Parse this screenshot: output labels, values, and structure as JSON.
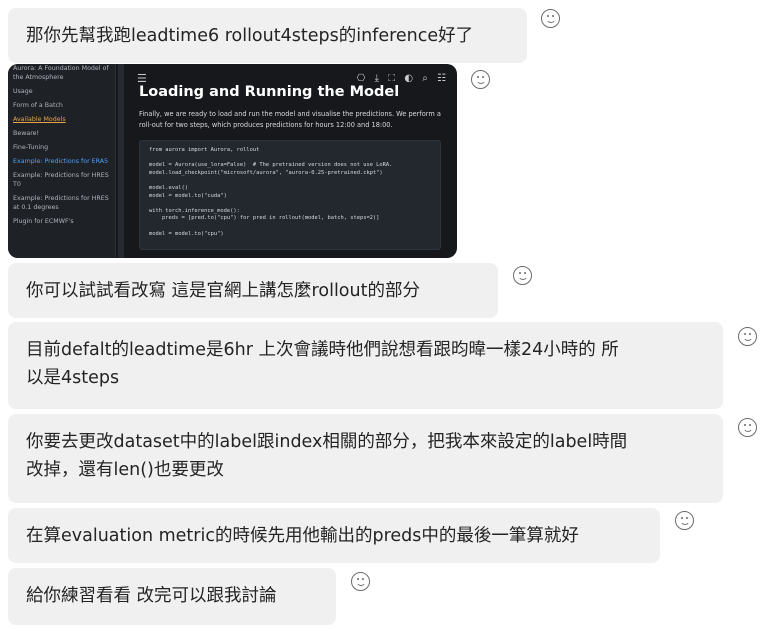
{
  "messages": [
    {
      "text": "那你先幫我跑leadtime6 rollout4steps的inference好了"
    },
    {
      "text": "你可以試試看改寫 這是官網上講怎麼rollout的部分"
    },
    {
      "line1": "目前defalt的leadtime是6hr 上次會議時他們說想看跟昀暐一樣24小時的 所",
      "line2": "以是4steps"
    },
    {
      "line1": "你要去更改dataset中的label跟index相關的部分，把我本來設定的label時間",
      "line2": "改掉，還有len()也要更改"
    },
    {
      "text": "在算evaluation metric的時候先用他輸出的preds中的最後一筆算就好"
    },
    {
      "text": "給你練習看看 改完可以跟我討論"
    }
  ],
  "reaction_icon": "smiley-react-icon",
  "screenshot": {
    "sidebar": [
      "Aurora: A Foundation Model of the Atmosphere",
      "Usage",
      "Form of a Batch",
      "Available Models",
      "Beware!",
      "Fine-Tuning",
      "Example: Predictions for ERA5",
      "Example: Predictions for HRES T0",
      "Example: Predictions for HRES at 0.1 degrees",
      "Plugin for ECMWF's"
    ],
    "menu_icon": "☰",
    "toolbar_icons": "⎔ ⤓ ⛶ ◐ ⌕ ☷",
    "heading": "Loading and Running the Model",
    "paragraph": "Finally, we are ready to load and run the model and visualise the predictions. We perform a roll-out for two steps, which produces predictions for hours 12:00 and 18:00.",
    "code_lines": [
      "from aurora import Aurora, rollout",
      "",
      "model = Aurora(use_lora=False)  # The pretrained version does not use LoRA.",
      "model.load_checkpoint(\"microsoft/aurora\", \"aurora-0.25-pretrained.ckpt\")",
      "",
      "model.eval()",
      "model = model.to(\"cuda\")",
      "",
      "with torch.inference_mode():",
      "    preds = [pred.to(\"cpu\") for pred in rollout(model, batch, steps=2)]",
      "",
      "model = model.to(\"cpu\")"
    ]
  }
}
